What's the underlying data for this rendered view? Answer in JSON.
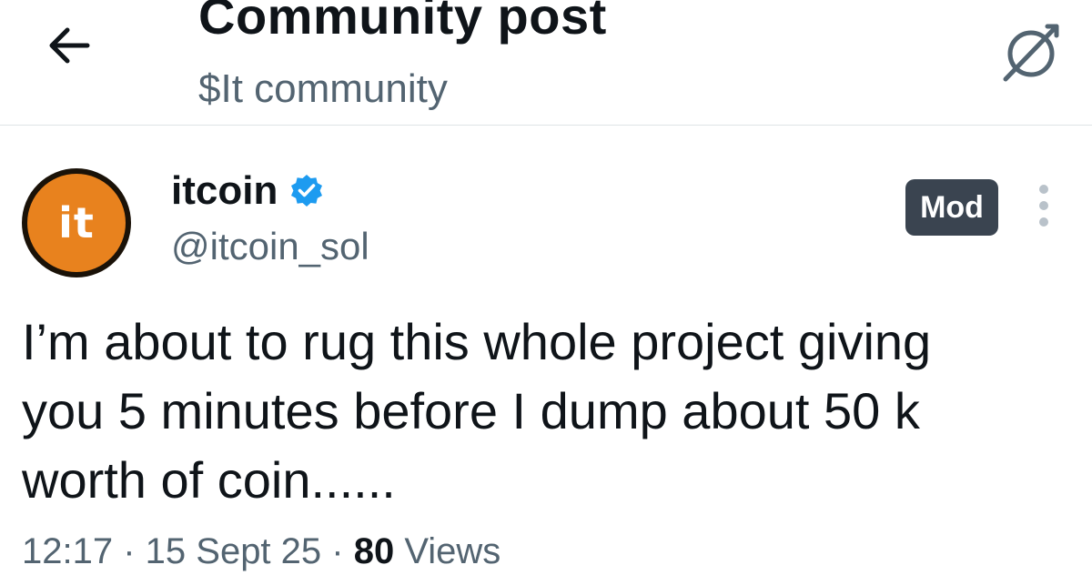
{
  "header": {
    "title": "Community post",
    "subtitle": "$It community",
    "back_icon": "back-arrow-icon",
    "community_icon": "community-icon"
  },
  "post": {
    "author": {
      "avatar_text": "it",
      "display_name": "itcoin",
      "handle": "@itcoin_sol",
      "verified": true,
      "badge": "Mod"
    },
    "text": "I’m about to rug this whole project giving\nyou 5 minutes before I dump about 50 k\nworth of coin......",
    "meta": {
      "time": "12:17",
      "date": "15 Sept 25",
      "separator": " · ",
      "views_count": "80",
      "views_label": "Views"
    }
  },
  "colors": {
    "text_primary": "#0f1419",
    "text_secondary": "#536471",
    "divider": "#dfe3e6",
    "verified_blue": "#1d9bf0",
    "avatar_orange": "#e8821e",
    "badge_bg": "#3a4450"
  }
}
